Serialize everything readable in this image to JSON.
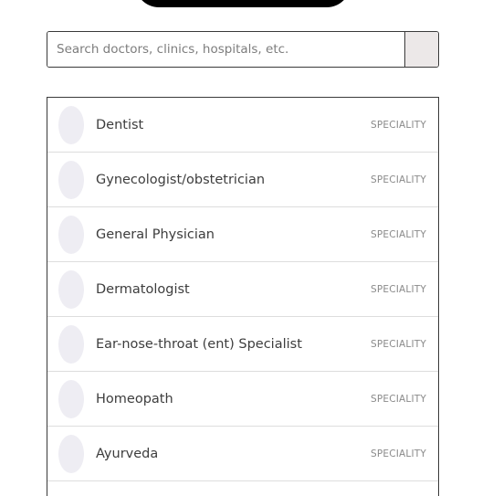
{
  "search": {
    "placeholder": "Search doctors, clinics, hospitals, etc."
  },
  "results": {
    "items": [
      {
        "name": "Dentist",
        "tag": "SPECIALITY"
      },
      {
        "name": "Gynecologist/obstetrician",
        "tag": "SPECIALITY"
      },
      {
        "name": "General Physician",
        "tag": "SPECIALITY"
      },
      {
        "name": "Dermatologist",
        "tag": "SPECIALITY"
      },
      {
        "name": "Ear-nose-throat (ent) Specialist",
        "tag": "SPECIALITY"
      },
      {
        "name": "Homeopath",
        "tag": "SPECIALITY"
      },
      {
        "name": "Ayurveda",
        "tag": "SPECIALITY"
      }
    ]
  },
  "colors": {
    "border": "#3a3a3a",
    "avatar": "#eeedf3",
    "search_button": "#ece8e8",
    "tag_text": "#8a8a8a"
  }
}
